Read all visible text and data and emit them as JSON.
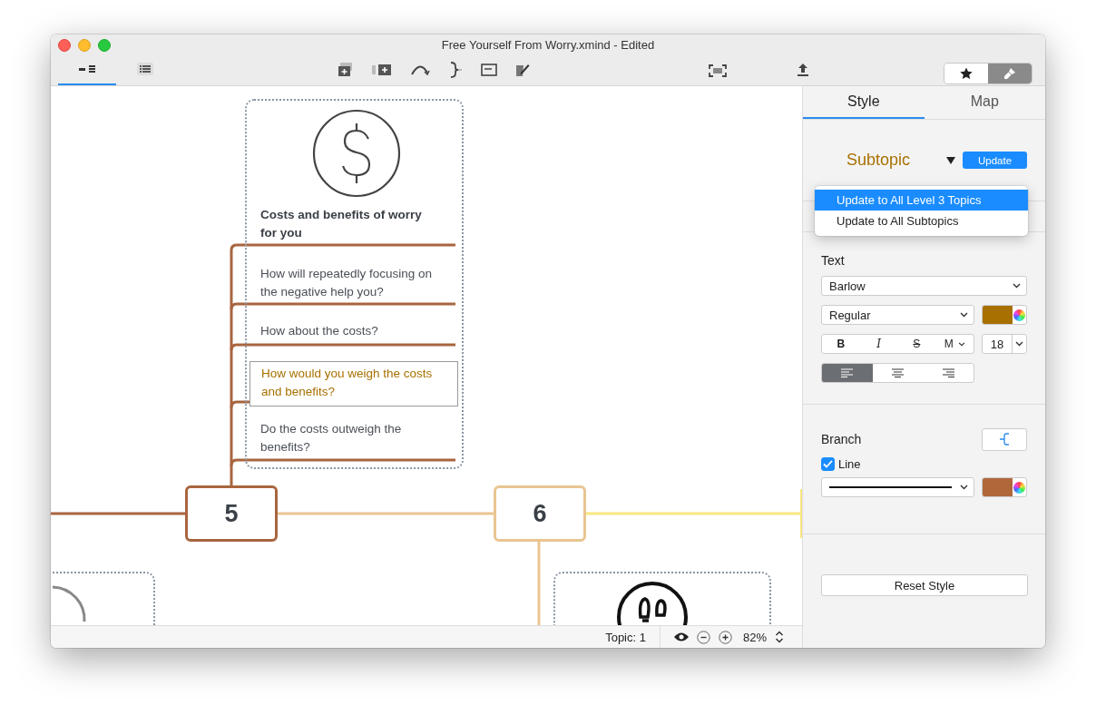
{
  "window": {
    "title": "Free Yourself From Worry.xmind - Edited"
  },
  "view_modes": [
    {
      "selected": true
    },
    {
      "selected": false
    }
  ],
  "panel_toggles": [
    {
      "selected": false
    },
    {
      "selected": true
    }
  ],
  "canvas": {
    "card": {
      "title": "Costs and benefits of worry for you",
      "subtopics": [
        {
          "text": "How will repeatedly focusing on the negative help you?",
          "selected": false
        },
        {
          "text": "How about the costs?",
          "selected": false
        },
        {
          "text": "How would you weigh the costs and benefits?",
          "selected": true
        },
        {
          "text": "Do the costs outweigh the benefits?",
          "selected": false
        }
      ]
    },
    "topics": [
      {
        "label": "5",
        "color": "#a8653f"
      },
      {
        "label": "6",
        "color": "#e9c591"
      }
    ]
  },
  "status_bar": {
    "topic": "Topic: 1",
    "zoom": "82%"
  },
  "panel": {
    "tabs": [
      {
        "label": "Style",
        "selected": true
      },
      {
        "label": "Map",
        "selected": false
      }
    ],
    "style_name": "Subtopic",
    "update_button": "Update",
    "menu": [
      {
        "label": "Update to All Level 3 Topics",
        "selected": true
      },
      {
        "label": "Update to All Subtopics",
        "selected": false
      }
    ],
    "text": {
      "heading": "Text",
      "font": "Barlow",
      "weight": "Regular",
      "color": "#a87000",
      "size": "18",
      "formats": [
        {
          "kind": "bold",
          "label": "B"
        },
        {
          "kind": "italic",
          "label": "I"
        },
        {
          "kind": "strike",
          "label": "S"
        },
        {
          "kind": "menu",
          "label": "M"
        }
      ],
      "alignment": [
        {
          "selected": true
        },
        {
          "selected": false
        },
        {
          "selected": false
        }
      ]
    },
    "branch": {
      "heading": "Branch",
      "line_label": "Line",
      "line_checked": true,
      "color": "#b0683b"
    },
    "reset_button": "Reset Style"
  }
}
